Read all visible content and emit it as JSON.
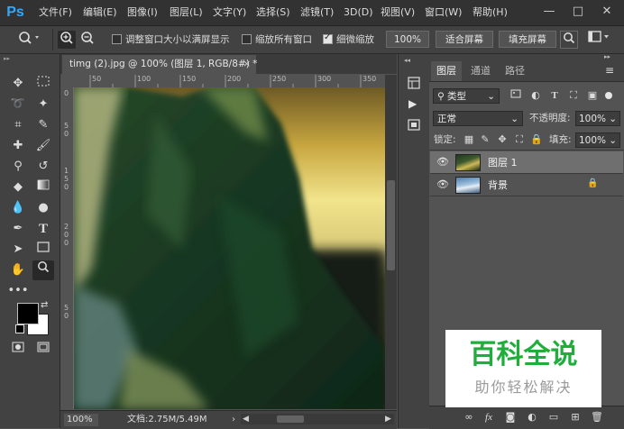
{
  "app": {
    "logo": "Ps"
  },
  "menu": [
    "文件(F)",
    "编辑(E)",
    "图像(I)",
    "图层(L)",
    "文字(Y)",
    "选择(S)",
    "滤镜(T)",
    "3D(D)",
    "视图(V)",
    "窗口(W)",
    "帮助(H)"
  ],
  "window_controls": [
    "—",
    "□",
    "✕"
  ],
  "options": {
    "resize_windows_label": "调整窗口大小以满屏显示",
    "resize_windows_checked": false,
    "zoom_all_label": "缩放所有窗口",
    "zoom_all_checked": false,
    "scrubby_zoom_label": "细微缩放",
    "scrubby_zoom_checked": true,
    "btn_100": "100%",
    "btn_fit": "适合屏幕",
    "btn_fill": "填充屏幕"
  },
  "document": {
    "tab_title": "timg (2).jpg @ 100% (图层 1, RGB/8#) *",
    "close": "×",
    "ruler_h": [
      "50",
      "100",
      "150",
      "200",
      "250",
      "300",
      "350"
    ],
    "ruler_v": [
      "0",
      "5",
      "0",
      "1",
      "5",
      "0",
      "2",
      "0",
      "0",
      "5",
      "0"
    ]
  },
  "status": {
    "zoom": "100%",
    "doc_info": "文档:2.75M/5.49M"
  },
  "layers_panel": {
    "tabs": [
      "图层",
      "通道",
      "路径"
    ],
    "active_tab": 0,
    "filter_kind": "类型",
    "blend_mode": "正常",
    "opacity_label": "不透明度:",
    "opacity_value": "100%",
    "lock_label": "锁定:",
    "fill_label": "填充:",
    "fill_value": "100%",
    "layers": [
      {
        "name": "图层 1",
        "selected": true,
        "locked": false
      },
      {
        "name": "背景",
        "selected": false,
        "locked": true
      }
    ]
  },
  "watermark": {
    "title": "百科全说",
    "subtitle": "助你轻松解决"
  },
  "colors": {
    "foreground": "#000000",
    "background": "#ffffff",
    "accent": "#31a8ff",
    "watermark_green": "#1fae3c"
  }
}
